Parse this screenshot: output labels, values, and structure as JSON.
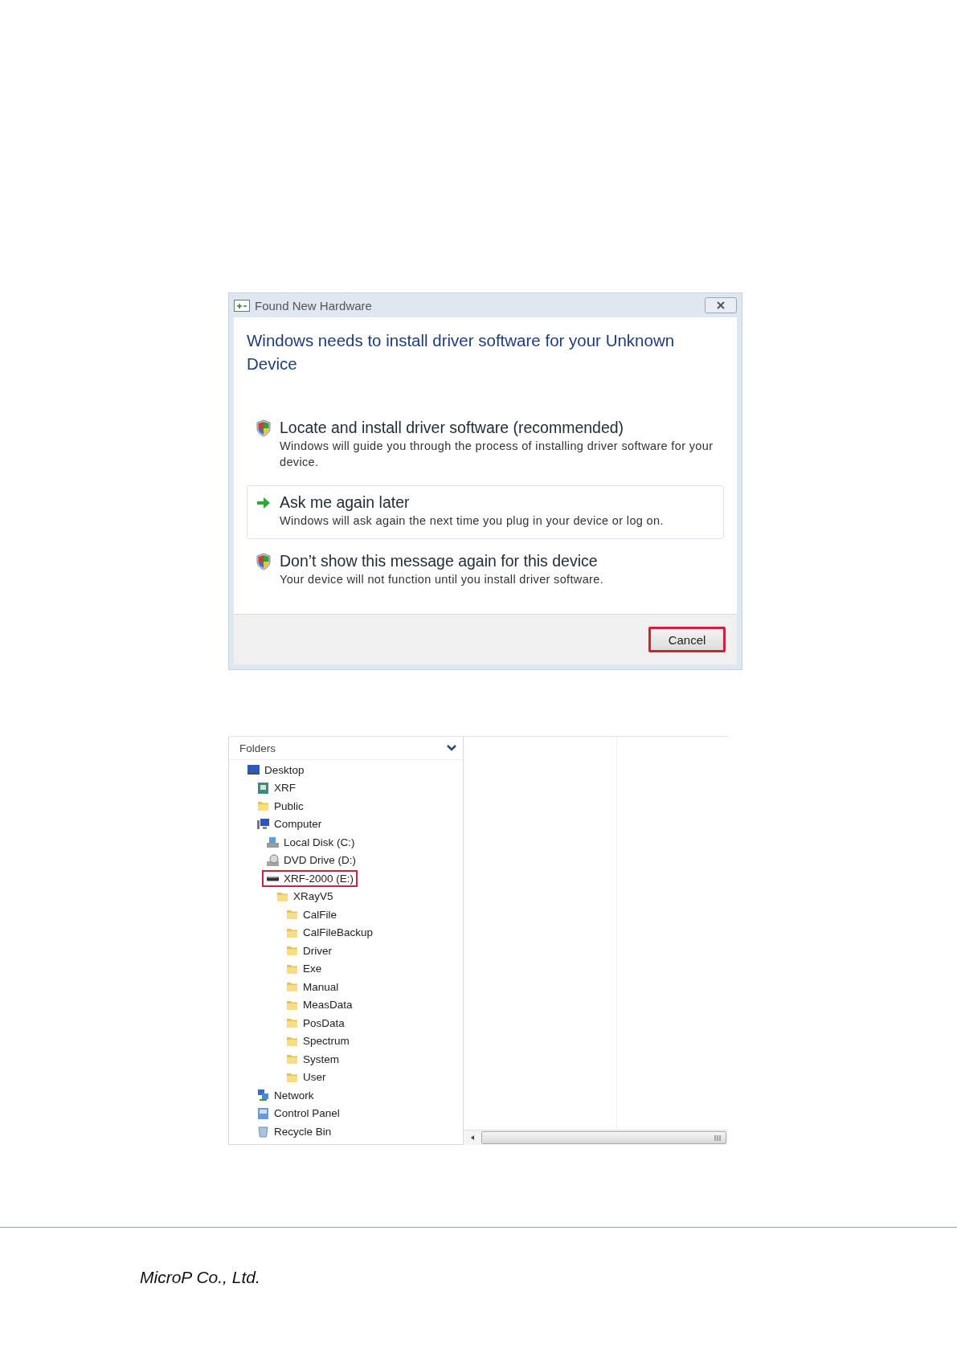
{
  "dialog": {
    "title": "Found New Hardware",
    "heading": "Windows needs to install driver software for your Unknown Device",
    "options": [
      {
        "kind": "shield",
        "title": "Locate and install driver software (recommended)",
        "description": "Windows will guide you through the process of installing driver software for your device.",
        "hovered": false
      },
      {
        "kind": "arrow",
        "title": "Ask me again later",
        "description": "Windows will ask again the next time you plug in your device or log on.",
        "hovered": true
      },
      {
        "kind": "shield",
        "title": "Don’t show this message again for this device",
        "description": "Your device will not function until you install driver software.",
        "hovered": false
      }
    ],
    "cancel": {
      "label": "Cancel",
      "highlighted": true
    }
  },
  "folders": {
    "header": "Folders",
    "items": [
      {
        "label": "Desktop",
        "kind": "desktop",
        "highlighted": false,
        "children": [
          {
            "label": "XRF",
            "kind": "user",
            "highlighted": false
          },
          {
            "label": "Public",
            "kind": "folder",
            "highlighted": false
          },
          {
            "label": "Computer",
            "kind": "computer",
            "highlighted": false,
            "children": [
              {
                "label": "Local Disk (C:)",
                "kind": "disk",
                "highlighted": false
              },
              {
                "label": "DVD Drive (D:)",
                "kind": "dvd",
                "highlighted": false
              },
              {
                "label": "XRF-2000 (E:)",
                "kind": "drive",
                "highlighted": true,
                "children": [
                  {
                    "label": "XRayV5",
                    "kind": "folder",
                    "highlighted": false,
                    "children": [
                      {
                        "label": "CalFile",
                        "kind": "folder",
                        "highlighted": false
                      },
                      {
                        "label": "CalFileBackup",
                        "kind": "folder",
                        "highlighted": false
                      },
                      {
                        "label": "Driver",
                        "kind": "folder",
                        "highlighted": false
                      },
                      {
                        "label": "Exe",
                        "kind": "folder",
                        "highlighted": false
                      },
                      {
                        "label": "Manual",
                        "kind": "folder",
                        "highlighted": false
                      },
                      {
                        "label": "MeasData",
                        "kind": "folder",
                        "highlighted": false
                      },
                      {
                        "label": "PosData",
                        "kind": "folder",
                        "highlighted": false
                      },
                      {
                        "label": "Spectrum",
                        "kind": "folder",
                        "highlighted": false
                      },
                      {
                        "label": "System",
                        "kind": "folder",
                        "highlighted": false
                      },
                      {
                        "label": "User",
                        "kind": "folder",
                        "highlighted": false
                      }
                    ]
                  }
                ]
              }
            ]
          },
          {
            "label": "Network",
            "kind": "network",
            "highlighted": false
          },
          {
            "label": "Control Panel",
            "kind": "control-panel",
            "highlighted": false
          },
          {
            "label": "Recycle Bin",
            "kind": "recycle",
            "highlighted": false
          }
        ]
      }
    ]
  },
  "footer": {
    "company": "MicroP Co., Ltd."
  }
}
